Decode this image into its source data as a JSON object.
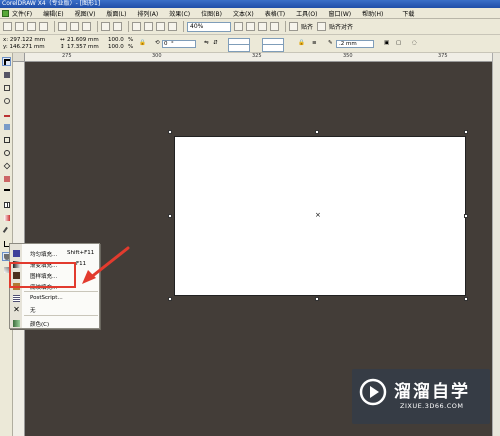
{
  "window": {
    "title": "CorelDRAW X4（专业版）- [图形1]"
  },
  "menubar": {
    "items": [
      "文件(F)",
      "编辑(E)",
      "视图(V)",
      "版面(L)",
      "排列(A)",
      "效果(C)",
      "位图(B)",
      "文本(X)",
      "表格(T)",
      "工具(O)",
      "窗口(W)",
      "帮助(H)"
    ],
    "extra": "下载"
  },
  "toolbar": {
    "zoom": "40%",
    "snap_label": "贴齐",
    "options_label": "贴齐对齐"
  },
  "propertybar": {
    "x": "x: 297.122 mm",
    "y": "y: 146.271 mm",
    "width": "21.609 mm",
    "height": "17.357 mm",
    "scale_x": "100.0",
    "scale_y": "100.0",
    "scale_unit": "%",
    "rotation": "0",
    "rotation_unit": "°",
    "outline_width": ".2 mm"
  },
  "ruler": {
    "top_ticks": [
      "275",
      "300",
      "325",
      "350",
      "375"
    ]
  },
  "fill_menu": {
    "items": [
      {
        "label": "均匀填充...",
        "shortcut": "Shift+F11",
        "icon": "uniform-fill-icon",
        "color": "#3f3f9a"
      },
      {
        "label": "渐变填充...",
        "shortcut": "F11",
        "icon": "fountain-fill-icon",
        "color": "#5a5a5a"
      },
      {
        "label": "图样填充...",
        "shortcut": "",
        "icon": "pattern-fill-icon",
        "color": "#4a2e1d"
      },
      {
        "label": "底纹填充...",
        "shortcut": "",
        "icon": "texture-fill-icon",
        "color": "#b07a35"
      },
      {
        "label": "PostScript...",
        "shortcut": "",
        "icon": "postscript-fill-icon",
        "color": "#4f4f72"
      },
      {
        "label": "无",
        "shortcut": "",
        "icon": "no-fill-icon",
        "color": "#000000"
      },
      {
        "label": "颜色(C)",
        "shortcut": "",
        "icon": "color-docker-icon",
        "color": "#3b6d3b"
      }
    ]
  },
  "annotation": {
    "color": "#e23b2e"
  },
  "watermark": {
    "title": "溜溜自学",
    "subtitle": "ZIXUE.3D66.COM"
  }
}
